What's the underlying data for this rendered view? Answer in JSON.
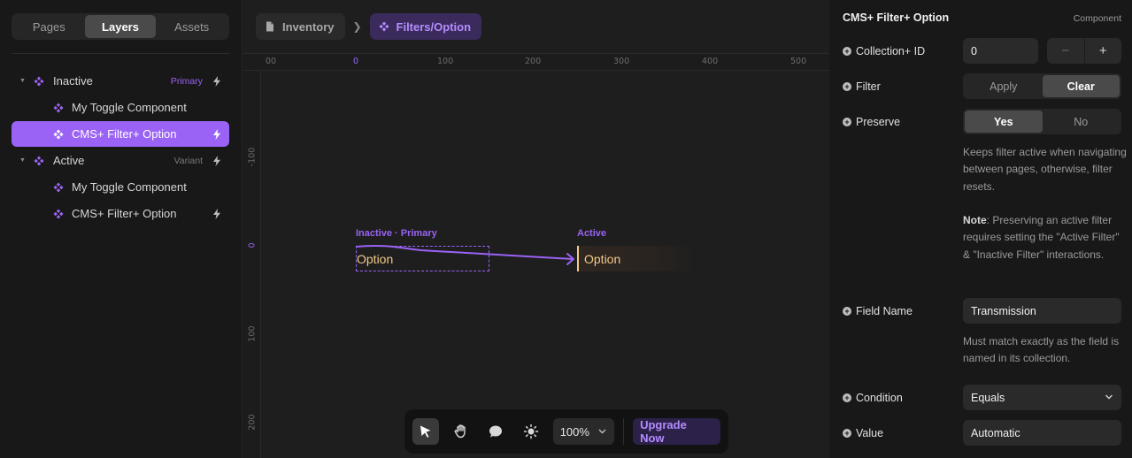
{
  "left_panel": {
    "tabs": [
      {
        "label": "Pages",
        "active": false
      },
      {
        "label": "Layers",
        "active": true
      },
      {
        "label": "Assets",
        "active": false
      }
    ],
    "layers": [
      {
        "label": "Inactive",
        "tag": "Primary",
        "tag_color": "#9b63f5",
        "level": 0,
        "expanded": true,
        "bolt": true,
        "selected": false
      },
      {
        "label": "My Toggle Component",
        "tag": "",
        "level": 1,
        "bolt": false,
        "selected": false
      },
      {
        "label": "CMS+ Filter+ Option",
        "tag": "",
        "level": 1,
        "bolt": true,
        "selected": true
      },
      {
        "label": "Active",
        "tag": "Variant",
        "tag_color": "#7a7a7a",
        "level": 0,
        "expanded": true,
        "bolt": true,
        "selected": false
      },
      {
        "label": "My Toggle Component",
        "tag": "",
        "level": 1,
        "bolt": false,
        "selected": false
      },
      {
        "label": "CMS+ Filter+ Option",
        "tag": "",
        "level": 1,
        "bolt": true,
        "selected": false
      }
    ]
  },
  "canvas": {
    "breadcrumb": [
      {
        "label": "Inventory",
        "icon": "page-icon"
      },
      {
        "label": "Filters/Option",
        "icon": "component-icon"
      }
    ],
    "ruler_top_ticks": [
      "00",
      "0",
      "100",
      "200",
      "300",
      "400",
      "500"
    ],
    "ruler_left_ticks": [
      "-100",
      "0",
      "100",
      "200"
    ],
    "states": [
      {
        "label": "Inactive · Primary",
        "text": "Option"
      },
      {
        "label": "Active",
        "text": "Option"
      }
    ],
    "toolbar": {
      "zoom": "100%",
      "upgrade_label": "Upgrade Now",
      "tools": [
        "cursor-icon",
        "hand-icon",
        "comment-icon",
        "sun-icon"
      ]
    }
  },
  "right_panel": {
    "title": "CMS+ Filter+ Option",
    "type": "Component",
    "collection_id": {
      "label": "Collection+ ID",
      "value": "0",
      "minus": "−",
      "plus": "+"
    },
    "filter": {
      "label": "Filter",
      "options": [
        "Apply",
        "Clear"
      ],
      "selected": "Clear"
    },
    "preserve": {
      "label": "Preserve",
      "options": [
        "Yes",
        "No"
      ],
      "selected": "Yes",
      "help": "Keeps filter active when navigating between pages, otherwise, filter resets.",
      "note_label": "Note",
      "note": ": Preserving an active filter requires setting the \"Active Filter\" & \"Inactive Filter\" interactions."
    },
    "field_name": {
      "label": "Field Name",
      "value": "Transmission",
      "help": "Must match exactly as the field is named in its collection."
    },
    "condition": {
      "label": "Condition",
      "value": "Equals"
    },
    "value": {
      "label": "Value",
      "value": "Automatic"
    }
  },
  "colors": {
    "accent": "#9b63f5",
    "option_text": "#f2c98a"
  }
}
